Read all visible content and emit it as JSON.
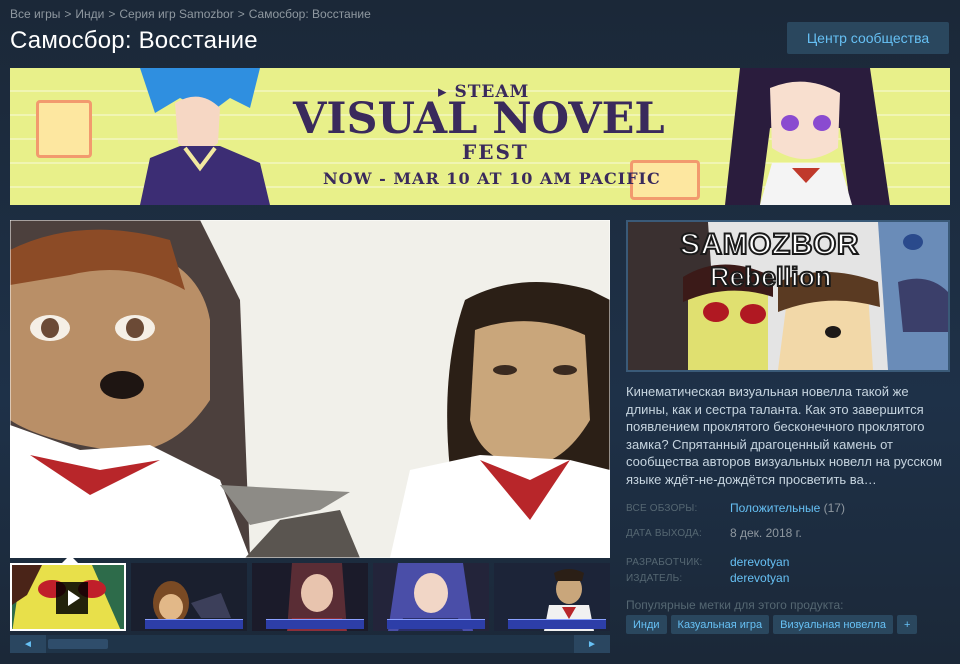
{
  "breadcrumbs": [
    "Все игры",
    "Инди",
    "Серия игр Samozbor",
    "Самосбор: Восстание"
  ],
  "breadcrumb_separator": ">",
  "page_title": "Самосбор: Восстание",
  "community_button": "Центр сообщества",
  "banner": {
    "steam_label": "STEAM",
    "title": "VISUAL NOVEL",
    "subtitle": "FEST",
    "date": "NOW - MAR 10 AT 10 AM PACIFIC",
    "background_color": "#e8f08a",
    "text_color": "#3a2a5c"
  },
  "media": {
    "thumbnail_count": 5,
    "active_thumbnail": 0,
    "scroll_left": "◄",
    "scroll_right": "►"
  },
  "capsule": {
    "title_line1": "SAMOZBOR",
    "title_line2": "Rebellion"
  },
  "description": "Кинематическая визуальная новелла такой же длины, как и сестра таланта. Как это завершится появлением проклятого бесконечного проклятого замка? Спрятанный драгоценный камень от сообщества авторов визуальных новелл на русском языке ждёт-не-дождётся просветить ва…",
  "reviews": {
    "label": "ВСЕ ОБЗОРЫ:",
    "value": "Положительные",
    "count": "(17)"
  },
  "release": {
    "label": "ДАТА ВЫХОДА:",
    "value": "8 дек. 2018 г."
  },
  "developer": {
    "label": "РАЗРАБОТЧИК:",
    "value": "derevotyan"
  },
  "publisher": {
    "label": "ИЗДАТЕЛЬ:",
    "value": "derevotyan"
  },
  "tags_label": "Популярные метки для этого продукта:",
  "tags": [
    "Инди",
    "Казуальная игра",
    "Визуальная новелла",
    "+"
  ],
  "colors": {
    "background": "#1b2838",
    "link": "#66c0f4",
    "button_bg": "#2a475e",
    "label": "#556772"
  }
}
